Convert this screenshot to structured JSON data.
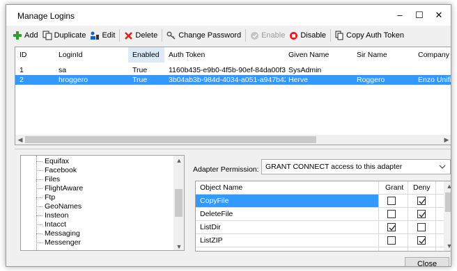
{
  "window": {
    "title": "Manage Logins",
    "minimize_glyph": "–",
    "maximize_glyph": "☐",
    "close_glyph": "✕"
  },
  "toolbar": {
    "add": "Add",
    "duplicate": "Duplicate",
    "edit": "Edit",
    "delete": "Delete",
    "change_password": "Change Password",
    "enable": "Enable",
    "disable": "Disable",
    "copy_auth_token": "Copy Auth Token"
  },
  "logins": {
    "columns": [
      "ID",
      "LoginId",
      "Enabled",
      "Auth Token",
      "Given Name",
      "Sir Name",
      "Company Nam"
    ],
    "rows": [
      {
        "id": "1",
        "login": "sa",
        "enabled": "True",
        "token": "1160b435-e9b0-4f5b-90ef-84da00f33...",
        "given": "SysAdmin",
        "sir": "",
        "company": ""
      },
      {
        "id": "2",
        "login": "hroggero",
        "enabled": "True",
        "token": "3b04ab3b-984d-4034-a051-a947b42...",
        "given": "Herve",
        "sir": "Roggero",
        "company": "Enzo Unified"
      }
    ],
    "selected_row": 2
  },
  "adapters": [
    "Equifax",
    "Facebook",
    "Files",
    "FlightAware",
    "Ftp",
    "GeoNames",
    "Insteon",
    "Intacct",
    "Messaging",
    "Messenger"
  ],
  "permission": {
    "label": "Adapter Permission:",
    "value": "GRANT CONNECT access to this adapter"
  },
  "objects": {
    "columns": [
      "Object Name",
      "Grant",
      "Deny"
    ],
    "rows": [
      {
        "name": "CopyFile",
        "grant": false,
        "deny": true,
        "selected": true
      },
      {
        "name": "DeleteFile",
        "grant": false,
        "deny": true,
        "selected": false
      },
      {
        "name": "ListDir",
        "grant": true,
        "deny": false,
        "selected": false
      },
      {
        "name": "ListZIP",
        "grant": false,
        "deny": true,
        "selected": false
      }
    ]
  },
  "buttons": {
    "close": "Close"
  },
  "colors": {
    "selection": "#3399ff",
    "window_bg": "#f0f0f0",
    "add_icon": "#2e9e2e",
    "delete_icon": "#d9231f",
    "disable_icon": "#e02020"
  },
  "icons": [
    "add-icon",
    "duplicate-icon",
    "edit-icon",
    "delete-icon",
    "key-icon",
    "enable-icon",
    "disable-icon",
    "copy-icon"
  ]
}
